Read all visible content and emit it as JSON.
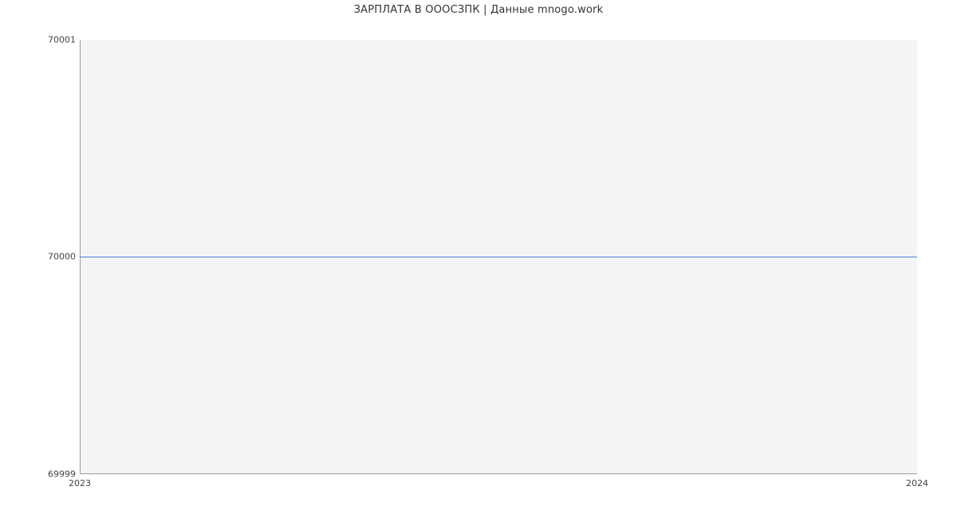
{
  "chart_data": {
    "type": "line",
    "title": "ЗАРПЛАТА В ОООСЗПК | Данные mnogo.work",
    "x": [
      2023,
      2024
    ],
    "values": [
      70000,
      70000
    ],
    "xlim": [
      2023,
      2024
    ],
    "ylim": [
      69999,
      70001
    ],
    "xticks": [
      2023,
      2024
    ],
    "yticks": [
      69999,
      70000,
      70001
    ],
    "xlabel": "",
    "ylabel": ""
  }
}
